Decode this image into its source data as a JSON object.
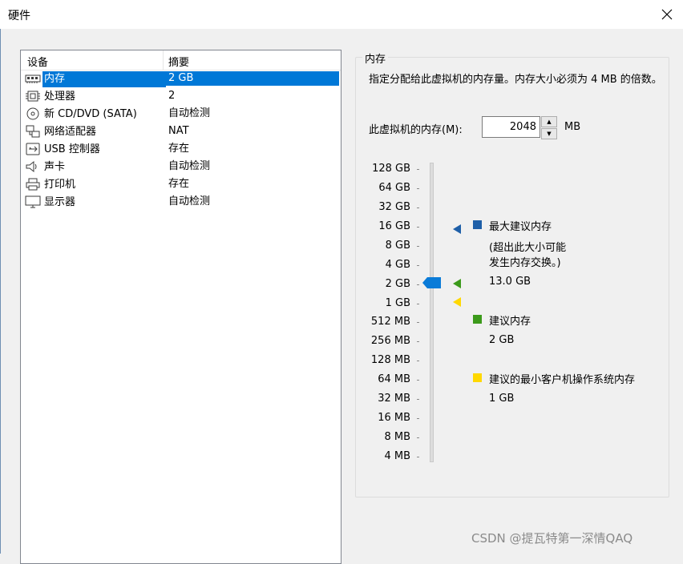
{
  "window": {
    "title": "硬件"
  },
  "devices": {
    "header": {
      "device": "设备",
      "summary": "摘要"
    },
    "rows": [
      {
        "label": "内存",
        "summary": "2 GB",
        "icon": "memory-icon"
      },
      {
        "label": "处理器",
        "summary": "2",
        "icon": "cpu-icon"
      },
      {
        "label": "新 CD/DVD (SATA)",
        "summary": "自动检测",
        "icon": "cd-dvd-icon"
      },
      {
        "label": "网络适配器",
        "summary": "NAT",
        "icon": "network-icon"
      },
      {
        "label": "USB 控制器",
        "summary": "存在",
        "icon": "usb-icon"
      },
      {
        "label": "声卡",
        "summary": "自动检测",
        "icon": "speaker-icon"
      },
      {
        "label": "打印机",
        "summary": "存在",
        "icon": "printer-icon"
      },
      {
        "label": "显示器",
        "summary": "自动检测",
        "icon": "monitor-icon"
      }
    ]
  },
  "memory": {
    "group_title": "内存",
    "description": "指定分配给此虚拟机的内存量。内存大小必须为 4 MB 的倍数。",
    "field_label": "此虚拟机的内存(M):",
    "value": "2048",
    "unit": "MB",
    "slider_value": "2 GB",
    "ticks": [
      "128 GB",
      "64 GB",
      "32 GB",
      "16 GB",
      "8 GB",
      "4 GB",
      "2 GB",
      "1 GB",
      "512 MB",
      "256 MB",
      "128 MB",
      "64 MB",
      "32 MB",
      "16 MB",
      "8 MB",
      "4 MB"
    ],
    "legend": {
      "max": {
        "title": "最大建议内存",
        "note1": "(超出此大小可能",
        "note2": "发生内存交换。)",
        "value": "13.0 GB",
        "color": "#1e5fa8"
      },
      "recommended": {
        "title": "建议内存",
        "value": "2 GB",
        "color": "#3c9a1b"
      },
      "min": {
        "title": "建议的最小客户机操作系统内存",
        "value": "1 GB",
        "color": "#ffd800"
      }
    }
  },
  "watermark": "CSDN @提瓦特第一深情QAQ"
}
